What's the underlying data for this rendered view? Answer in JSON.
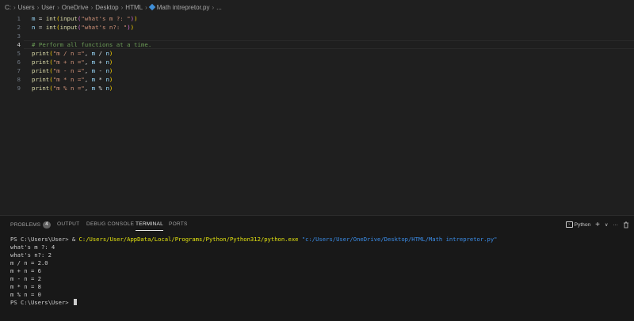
{
  "breadcrumb": {
    "items": [
      "C:",
      "Users",
      "User",
      "OneDrive",
      "Desktop",
      "HTML"
    ],
    "file": "Math intrepretor.py",
    "ellipsis": "..."
  },
  "editor": {
    "lines": [
      {
        "number": "1",
        "segments": [
          [
            "v",
            "m"
          ],
          [
            "o",
            " = "
          ],
          [
            "f",
            "int"
          ],
          [
            "p",
            "("
          ],
          [
            "f",
            "input"
          ],
          [
            "p2",
            "("
          ],
          [
            "s",
            "\"what's m ?: \""
          ],
          [
            "p2",
            ")"
          ],
          [
            "p",
            ")"
          ]
        ]
      },
      {
        "number": "2",
        "segments": [
          [
            "v",
            "n"
          ],
          [
            "o",
            " = "
          ],
          [
            "f",
            "int"
          ],
          [
            "p",
            "("
          ],
          [
            "f",
            "input"
          ],
          [
            "p2",
            "("
          ],
          [
            "s",
            "\"what's n?: \""
          ],
          [
            "p2",
            ")"
          ],
          [
            "p",
            ")"
          ]
        ]
      },
      {
        "number": "3",
        "segments": []
      },
      {
        "number": "4",
        "segments": [
          [
            "c",
            "# Perform all functions at a time."
          ]
        ]
      },
      {
        "number": "5",
        "segments": [
          [
            "f",
            "print"
          ],
          [
            "p",
            "("
          ],
          [
            "s",
            "\"m / n =\""
          ],
          [
            "o",
            ", "
          ],
          [
            "v",
            "m"
          ],
          [
            "o",
            " / "
          ],
          [
            "v",
            "n"
          ],
          [
            "p",
            ")"
          ]
        ]
      },
      {
        "number": "6",
        "segments": [
          [
            "f",
            "print"
          ],
          [
            "p",
            "("
          ],
          [
            "s",
            "\"m + n =\""
          ],
          [
            "o",
            ", "
          ],
          [
            "v",
            "m"
          ],
          [
            "o",
            " + "
          ],
          [
            "v",
            "n"
          ],
          [
            "p",
            ")"
          ]
        ]
      },
      {
        "number": "7",
        "segments": [
          [
            "f",
            "print"
          ],
          [
            "p",
            "("
          ],
          [
            "s",
            "\"m - n =\""
          ],
          [
            "o",
            ", "
          ],
          [
            "v",
            "m"
          ],
          [
            "o",
            " - "
          ],
          [
            "v",
            "n"
          ],
          [
            "p",
            ")"
          ]
        ]
      },
      {
        "number": "8",
        "segments": [
          [
            "f",
            "print"
          ],
          [
            "p",
            "("
          ],
          [
            "s",
            "\"m * n =\""
          ],
          [
            "o",
            ", "
          ],
          [
            "v",
            "m"
          ],
          [
            "o",
            " * "
          ],
          [
            "v",
            "n"
          ],
          [
            "p",
            ")"
          ]
        ]
      },
      {
        "number": "9",
        "segments": [
          [
            "f",
            "print"
          ],
          [
            "p",
            "("
          ],
          [
            "s",
            "\"m % n =\""
          ],
          [
            "o",
            ", "
          ],
          [
            "v",
            "m"
          ],
          [
            "o",
            " % "
          ],
          [
            "v",
            "n"
          ],
          [
            "p",
            ")"
          ]
        ]
      }
    ]
  },
  "panel": {
    "tabs": {
      "problems": "PROBLEMS",
      "problems_count": "4",
      "output": "OUTPUT",
      "debug_console": "DEBUG CONSOLE",
      "terminal": "TERMINAL",
      "ports": "PORTS"
    },
    "toolbar": {
      "shell": "Python",
      "add": "+",
      "dropdown": "∨",
      "more": "···"
    },
    "terminal": {
      "command_prompt": "PS C:\\Users\\User> & ",
      "command_exe": "C:/Users/User/AppData/Local/Programs/Python/Python312/python.exe",
      "command_arg": " \"c:/Users/User/OneDrive/Desktop/HTML/Math intrepretor.py\"",
      "output": [
        "what's m ?: 4",
        "what's n?: 2",
        "m / n = 2.0",
        "m + n = 6",
        "m - n = 2",
        "m * n = 8",
        "m % n = 0"
      ],
      "final_prompt": "PS C:\\Users\\User> "
    }
  },
  "colors": {
    "background": "#1f1f1f",
    "panel": "#181818",
    "variable": "#9cdcfe",
    "function": "#dcdcaa",
    "string": "#ce9178",
    "comment": "#6a9955",
    "terminal_exe": "#e5e510",
    "terminal_arg": "#3b8eea"
  }
}
